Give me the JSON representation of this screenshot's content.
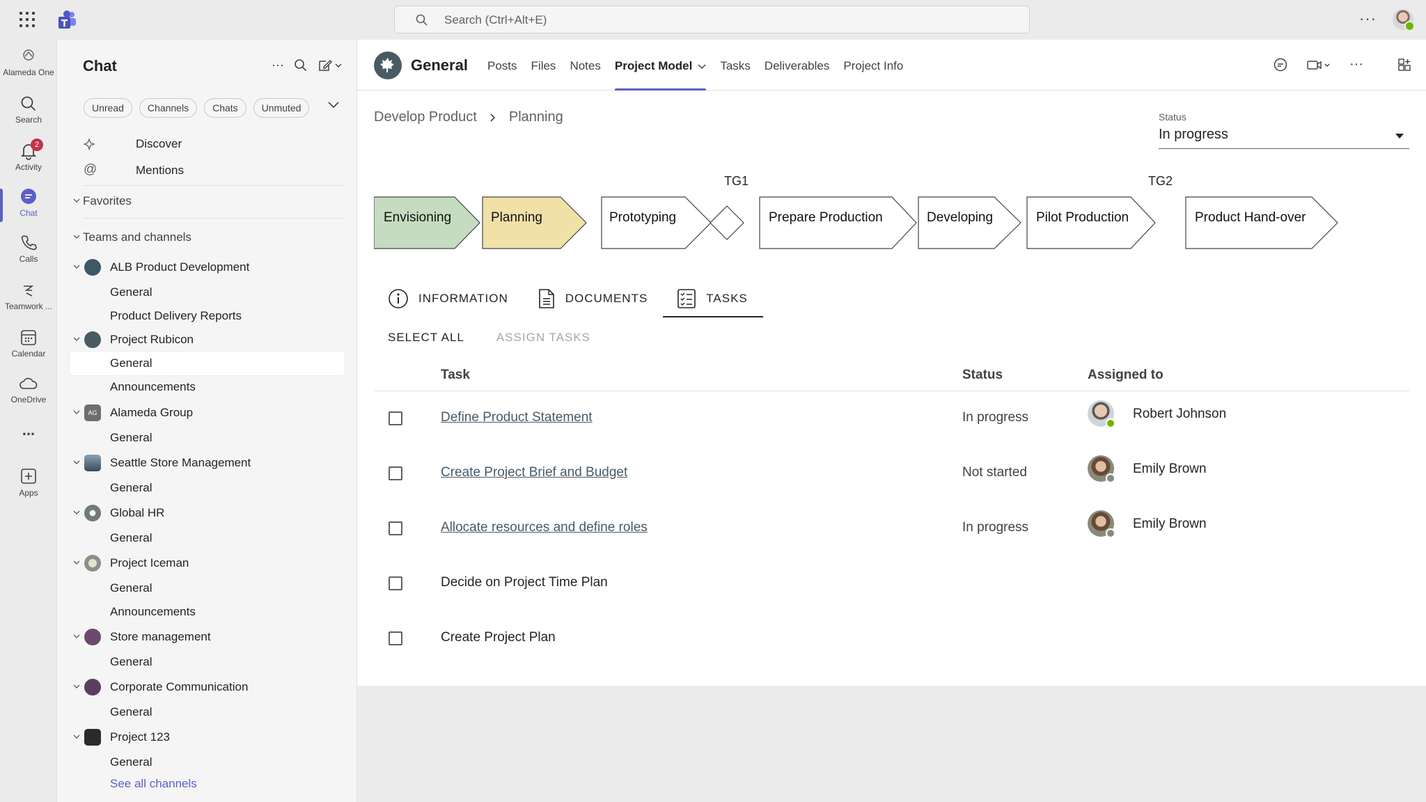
{
  "search": {
    "placeholder": "Search (Ctrl+Alt+E)"
  },
  "rail": {
    "items": [
      {
        "label": "Alameda One",
        "icon": "org-logo-icon"
      },
      {
        "label": "Search",
        "icon": "search-icon"
      },
      {
        "label": "Activity",
        "icon": "bell-icon",
        "badge": "2"
      },
      {
        "label": "Chat",
        "icon": "chat-icon",
        "active": true
      },
      {
        "label": "Calls",
        "icon": "phone-icon"
      },
      {
        "label": "Teamwork ...",
        "icon": "teamwork-icon"
      },
      {
        "label": "Calendar",
        "icon": "calendar-icon"
      },
      {
        "label": "OneDrive",
        "icon": "cloud-icon"
      },
      {
        "label": "...",
        "icon": "more-icon"
      },
      {
        "label": "Apps",
        "icon": "apps-add-icon"
      }
    ]
  },
  "sidebar": {
    "title": "Chat",
    "filters": [
      "Unread",
      "Channels",
      "Chats",
      "Unmuted"
    ],
    "discover": "Discover",
    "mentions": "Mentions",
    "favorites": "Favorites",
    "teams_header": "Teams and channels",
    "teams": [
      {
        "name": "ALB Product Development",
        "channels": [
          "General",
          "Product Delivery Reports"
        ]
      },
      {
        "name": "Project Rubicon",
        "channels": [
          "General",
          "Announcements"
        ]
      },
      {
        "name": "Alameda Group",
        "channels": [
          "General"
        ],
        "initials": "AG"
      },
      {
        "name": "Seattle Store Management",
        "channels": [
          "General"
        ]
      },
      {
        "name": "Global HR",
        "channels": [
          "General"
        ]
      },
      {
        "name": "Project Iceman",
        "channels": [
          "General",
          "Announcements"
        ]
      },
      {
        "name": "Store management",
        "channels": [
          "General"
        ]
      },
      {
        "name": "Corporate Communication",
        "channels": [
          "General"
        ]
      },
      {
        "name": "Project 123",
        "channels": [
          "General"
        ]
      }
    ],
    "see_all": "See all channels"
  },
  "channel": {
    "name": "General",
    "tabs": [
      "Posts",
      "Files",
      "Notes",
      "Project Model",
      "Tasks",
      "Deliverables",
      "Project Info"
    ],
    "active_tab": "Project Model"
  },
  "breadcrumb": [
    "Develop Product",
    "Planning"
  ],
  "status": {
    "caption": "Status",
    "value": "In progress"
  },
  "process": {
    "gates": [
      "TG1",
      "TG2"
    ],
    "stages": [
      "Envisioning",
      "Planning",
      "Prototyping",
      "Prepare Production",
      "Developing",
      "Pilot Production",
      "Product Hand-over"
    ],
    "colors": {
      "done": "#c5dcc0",
      "current": "#f0e1a8",
      "pending": "#ffffff"
    }
  },
  "subtabs": [
    "INFORMATION",
    "DOCUMENTS",
    "TASKS"
  ],
  "actions": {
    "select_all": "SELECT ALL",
    "assign": "ASSIGN TASKS"
  },
  "table": {
    "headers": {
      "task": "Task",
      "status": "Status",
      "assigned": "Assigned to"
    },
    "rows": [
      {
        "task": "Define Product Statement",
        "status": "In progress",
        "assignee": "Robert Johnson",
        "presence": "available"
      },
      {
        "task": "Create Project Brief and Budget",
        "status": "Not started",
        "assignee": "Emily Brown",
        "presence": "offline"
      },
      {
        "task": "Allocate resources and define roles",
        "status": "In progress",
        "assignee": "Emily Brown",
        "presence": "offline"
      },
      {
        "task": "Decide on Project Time Plan",
        "status": "",
        "assignee": ""
      },
      {
        "task": "Create Project Plan",
        "status": "",
        "assignee": ""
      }
    ]
  },
  "colors": {
    "accent": "#5b5fc7",
    "link": "#475a69",
    "badge": "#c4314b",
    "available": "#6bb700"
  }
}
